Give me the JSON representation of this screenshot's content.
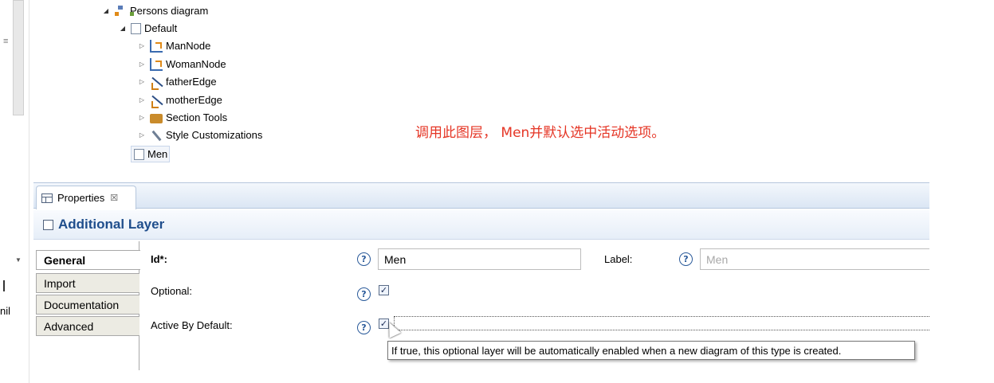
{
  "left_strip": {
    "nil_text": "nil"
  },
  "tree": {
    "items": [
      {
        "label": "Persons diagram",
        "icon": "diagram-icon",
        "expanded": true
      },
      {
        "label": "Default",
        "icon": "layer-icon",
        "expanded": true
      },
      {
        "label": "ManNode",
        "icon": "node-mapping-icon",
        "expanded": false
      },
      {
        "label": "WomanNode",
        "icon": "node-mapping-icon",
        "expanded": false
      },
      {
        "label": "fatherEdge",
        "icon": "edge-mapping-icon",
        "expanded": false
      },
      {
        "label": "motherEdge",
        "icon": "edge-mapping-icon",
        "expanded": false
      },
      {
        "label": "Section Tools",
        "icon": "tools-icon",
        "expanded": false
      },
      {
        "label": "Style Customizations",
        "icon": "wrench-icon",
        "expanded": false
      },
      {
        "label": "Men",
        "icon": "layer-icon",
        "selected": true
      }
    ]
  },
  "annotation": {
    "text": "调用此图层， Men并默认选中活动选项。",
    "color": "#e53525"
  },
  "properties": {
    "tab_label": "Properties",
    "header_title": "Additional Layer",
    "side_tabs": [
      "General",
      "Import",
      "Documentation",
      "Advanced"
    ],
    "active_side_tab": "General",
    "form": {
      "id_label": "Id*:",
      "id_value": "Men",
      "label_label": "Label:",
      "label_placeholder": "Men",
      "optional_label": "Optional:",
      "optional_checked": true,
      "active_label": "Active By Default:",
      "active_checked": true
    },
    "tooltip": "If true, this optional layer will be automatically enabled when a new diagram of this type is created."
  }
}
